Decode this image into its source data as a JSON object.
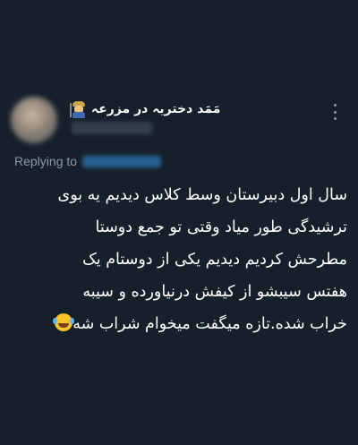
{
  "tweet": {
    "author": {
      "display_name": "مَمَد دختریہ در مزرعہ"
    },
    "menu_icon": "more-vertical-icon",
    "replying": {
      "label": "Replying to"
    },
    "text_lines": [
      "سال اول دبیرستان وسط کلاس دیدیم یه بوی",
      "ترشیدگی طور میاد وقتی تو جمع دوستا",
      "مطرحش کردیم دیدیم یکی از دوستام یک",
      "هفتس سیبشو از کیفش درنیاورده و سیبه",
      "خراب شده.تازه میگفت میخوام شراب شه"
    ],
    "emojis": {
      "name_emoji": "farmer-emoji",
      "end_emoji": "face-with-tears-of-joy-emoji"
    }
  },
  "colors": {
    "background": "#15202b",
    "text_primary": "#ffffff",
    "text_secondary": "#8b98a5",
    "link": "#1d9bf0"
  }
}
